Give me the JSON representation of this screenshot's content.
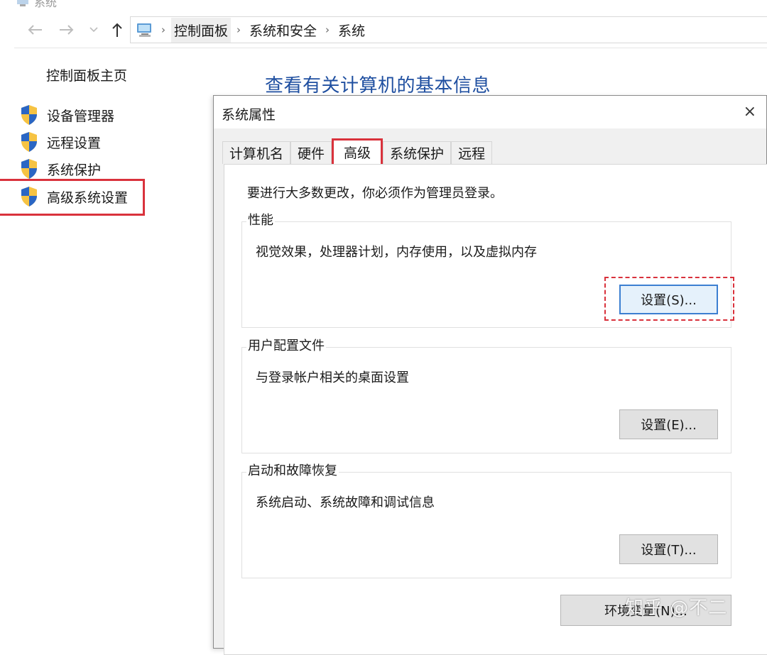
{
  "window": {
    "title": "系统"
  },
  "nav": {
    "breadcrumbs": [
      "控制面板",
      "系统和安全",
      "系统"
    ],
    "icons": {
      "back": "arrow-left-icon",
      "forward": "arrow-right-icon",
      "recent": "chevron-down-icon",
      "up": "arrow-up-icon"
    }
  },
  "left_panel": {
    "home": "控制面板主页",
    "items": [
      {
        "label": "设备管理器"
      },
      {
        "label": "远程设置"
      },
      {
        "label": "系统保护"
      },
      {
        "label": "高级系统设置"
      }
    ]
  },
  "main": {
    "heading": "查看有关计算机的基本信息"
  },
  "dialog": {
    "title": "系统属性",
    "close": "×",
    "tabs": [
      "计算机名",
      "硬件",
      "高级",
      "系统保护",
      "远程"
    ],
    "active_tab": "高级",
    "admin_note": "要进行大多数更改，你必须作为管理员登录。",
    "groups": [
      {
        "label": "性能",
        "description": "视觉效果，处理器计划，内存使用，以及虚拟内存",
        "button": "设置(S)..."
      },
      {
        "label": "用户配置文件",
        "description": "与登录帐户相关的桌面设置",
        "button": "设置(E)..."
      },
      {
        "label": "启动和故障恢复",
        "description": "系统启动、系统故障和调试信息",
        "button": "设置(T)..."
      }
    ],
    "env_button": "环境变量(N)..."
  },
  "watermark": "知乎 @不二",
  "colors": {
    "heading": "#1f4fa0",
    "highlight": "#d9323c",
    "focus": "#3c7fd1"
  }
}
